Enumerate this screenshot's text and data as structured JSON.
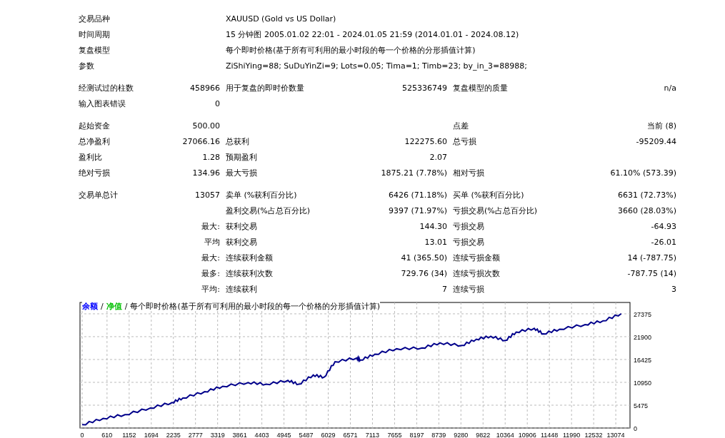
{
  "info": [
    {
      "label": "交易品种",
      "value": "XAUUSD (Gold vs US Dollar)"
    },
    {
      "label": "时间周期",
      "value": "15 分钟图 2005.01.02 22:01 - 2024.01.05 21:59 (2014.01.01 - 2024.08.12)"
    },
    {
      "label": "复盘模型",
      "value": "每个即时价格(基于所有可利用的最小时段的每一个价格的分形插值计算)"
    },
    {
      "label": "参数",
      "value": "ZiShiYing=88; SuDuYinZi=9; Lots=0.05; Tima=1; Timb=23; by_in_3=88988;"
    }
  ],
  "sections": [
    [
      {
        "label_1": "经测试过的柱数",
        "value_1": "458966",
        "label_2": "用于复盘的即时价数量",
        "value_2": "525336749",
        "label_3": "复盘模型的质量",
        "value_3": "n/a"
      },
      {
        "label_1": "输入图表错误",
        "value_1": "0"
      }
    ],
    [
      {
        "label_1": "起始资金",
        "value_1": "500.00",
        "label_3": "点差",
        "value_3": "当前 (8)"
      },
      {
        "label_1": "总净盈利",
        "value_1": "27066.16",
        "label_2": "总获利",
        "value_2": "122275.60",
        "label_3": "总亏损",
        "value_3": "-95209.44"
      },
      {
        "label_1": "盈利比",
        "value_1": "1.28",
        "label_2": "预期盈利",
        "value_2": "2.07"
      },
      {
        "label_1": "绝对亏损",
        "value_1": "134.96",
        "label_2": "最大亏损",
        "value_2": "1875.21 (7.78%)",
        "label_3": "相对亏损",
        "value_3": "61.10% (573.39)"
      }
    ],
    [
      {
        "label_1": "交易单总计",
        "value_1": "13057",
        "label_2": "卖单 (%获利百分比)",
        "value_2": "6426 (71.18%)",
        "label_3": "买单 (%获利百分比)",
        "value_3": "6631 (72.73%)"
      },
      {
        "label_2": "盈利交易(%占总百分比)",
        "value_2": "9397 (71.97%)",
        "label_3": "亏损交易(%占总百分比)",
        "value_3": "3660 (28.03%)"
      },
      {
        "value_1": "最大:",
        "label_2": "获利交易",
        "value_2": "144.30",
        "label_3": "亏损交易",
        "value_3": "-64.93"
      },
      {
        "value_1": "平均",
        "label_2": "获利交易",
        "value_2": "13.01",
        "label_3": "亏损交易",
        "value_3": "-26.01"
      },
      {
        "value_1": "最大:",
        "label_2": "连续获利金额",
        "value_2": "41 (365.50)",
        "label_3": "连续亏损金额",
        "value_3": "14 (-787.75)"
      },
      {
        "value_1": "最多:",
        "label_2": "连续获利次数",
        "value_2": "729.76 (34)",
        "label_3": "连续亏损次数",
        "value_3": "-787.75 (14)"
      },
      {
        "value_1": "平均:",
        "label_2": "连续获利",
        "value_2": "7",
        "label_3": "连续亏损",
        "value_3": "3"
      }
    ]
  ],
  "chart": {
    "legend": [
      {
        "kind": "series",
        "text": "余额",
        "color": "#0000ff"
      },
      {
        "kind": "text",
        "text": "/"
      },
      {
        "kind": "series",
        "text": "净值",
        "color": "#00c000"
      },
      {
        "kind": "text",
        "text": "/"
      },
      {
        "kind": "text",
        "text": "每个即时价格(基于所有可利用的最小时段的每一个价格的分形插值计算)"
      }
    ],
    "chart_data": {
      "type": "line",
      "grid": true,
      "xlim": [
        0,
        13370
      ],
      "ylim": [
        0,
        30100
      ],
      "xticks": [
        0,
        610,
        1152,
        1694,
        2235,
        2777,
        3319,
        3861,
        4403,
        4945,
        5487,
        6029,
        6571,
        7113,
        7655,
        8197,
        8739,
        9280,
        9822,
        10364,
        10906,
        11448,
        11990,
        12532,
        13074
      ],
      "yticks": [
        0,
        5475,
        10950,
        16425,
        21900,
        27375
      ],
      "x": [
        0,
        515,
        1047,
        1669,
        2201,
        2467,
        3000,
        3444,
        4065,
        4509,
        5041,
        5307,
        5663,
        5929,
        6195,
        6728,
        6817,
        7172,
        7704,
        8326,
        8769,
        9302,
        9657,
        10012,
        10367,
        10633,
        11077,
        11299,
        11698,
        12320,
        12763,
        13207
      ],
      "series": [
        {
          "color": "#00008b",
          "values": [
            800,
            2300,
            3200,
            4800,
            6100,
            7200,
            8700,
            10000,
            10900,
            10500,
            11400,
            10500,
            12700,
            12200,
            15900,
            16800,
            16300,
            17700,
            19000,
            19200,
            20400,
            19800,
            21300,
            22000,
            21000,
            23000,
            23900,
            22600,
            23700,
            24800,
            25700,
            27400
          ]
        }
      ]
    }
  }
}
